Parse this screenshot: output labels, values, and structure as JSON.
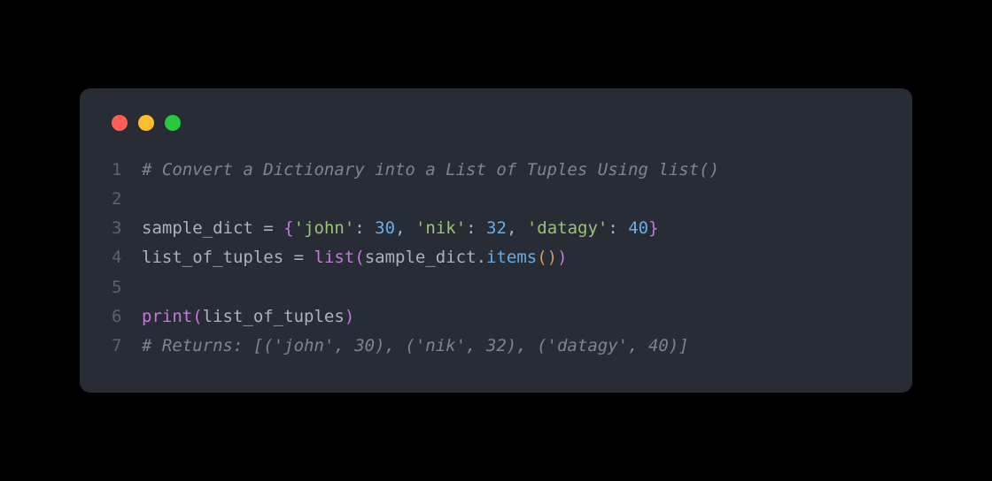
{
  "colors": {
    "window_bg": "#282c34",
    "page_bg": "#000000",
    "traffic_red": "#ff5f56",
    "traffic_yellow": "#ffbd2e",
    "traffic_green": "#27c93f",
    "comment": "#7f848e",
    "default": "#abb2bf",
    "string": "#98c379",
    "number": "#61afef",
    "keyword": "#c678dd",
    "method": "#61afef",
    "line_num": "#5c6370"
  },
  "lines": [
    {
      "num": "1",
      "tokens": [
        {
          "cls": "tok-comment",
          "text": "# Convert a Dictionary into a List of Tuples Using list()"
        }
      ]
    },
    {
      "num": "2",
      "tokens": []
    },
    {
      "num": "3",
      "tokens": [
        {
          "cls": "tok-default",
          "text": "sample_dict "
        },
        {
          "cls": "tok-operator",
          "text": "="
        },
        {
          "cls": "tok-default",
          "text": " "
        },
        {
          "cls": "tok-brace",
          "text": "{"
        },
        {
          "cls": "tok-string",
          "text": "'john'"
        },
        {
          "cls": "tok-punct",
          "text": ": "
        },
        {
          "cls": "tok-number",
          "text": "30"
        },
        {
          "cls": "tok-punct",
          "text": ", "
        },
        {
          "cls": "tok-string",
          "text": "'nik'"
        },
        {
          "cls": "tok-punct",
          "text": ": "
        },
        {
          "cls": "tok-number",
          "text": "32"
        },
        {
          "cls": "tok-punct",
          "text": ", "
        },
        {
          "cls": "tok-string",
          "text": "'datagy'"
        },
        {
          "cls": "tok-punct",
          "text": ": "
        },
        {
          "cls": "tok-number",
          "text": "40"
        },
        {
          "cls": "tok-brace",
          "text": "}"
        }
      ]
    },
    {
      "num": "4",
      "tokens": [
        {
          "cls": "tok-default",
          "text": "list_of_tuples "
        },
        {
          "cls": "tok-operator",
          "text": "="
        },
        {
          "cls": "tok-default",
          "text": " "
        },
        {
          "cls": "tok-builtin",
          "text": "list"
        },
        {
          "cls": "tok-brace",
          "text": "("
        },
        {
          "cls": "tok-default",
          "text": "sample_dict"
        },
        {
          "cls": "tok-punct",
          "text": "."
        },
        {
          "cls": "tok-method",
          "text": "items"
        },
        {
          "cls": "tok-paren-yellow",
          "text": "()"
        },
        {
          "cls": "tok-brace",
          "text": ")"
        }
      ]
    },
    {
      "num": "5",
      "tokens": []
    },
    {
      "num": "6",
      "tokens": [
        {
          "cls": "tok-builtin",
          "text": "print"
        },
        {
          "cls": "tok-brace",
          "text": "("
        },
        {
          "cls": "tok-default",
          "text": "list_of_tuples"
        },
        {
          "cls": "tok-brace",
          "text": ")"
        }
      ]
    },
    {
      "num": "7",
      "tokens": [
        {
          "cls": "tok-comment",
          "text": "# Returns: [('john', 30), ('nik', 32), ('datagy', 40)]"
        }
      ]
    }
  ]
}
